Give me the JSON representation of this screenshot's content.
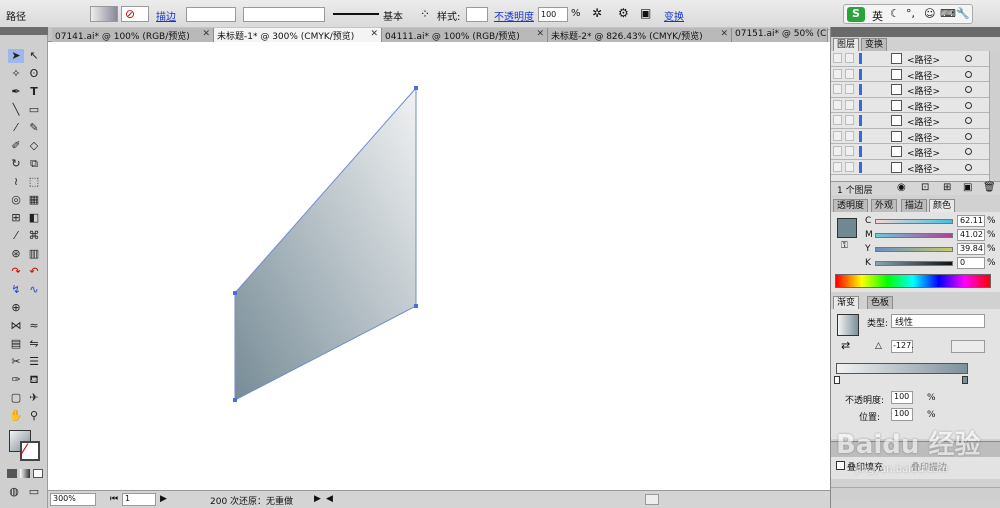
{
  "control_bar": {
    "selection_label": "路径",
    "stroke_link": "描边",
    "stroke_profile": "基本",
    "style_label": "样式:",
    "opacity_link": "不透明度",
    "opacity_value": "100",
    "opacity_unit": "%",
    "transform_link": "变换",
    "ime_label": "英"
  },
  "tabs": [
    {
      "label": "07141.ai* @ 100% (RGB/预览)"
    },
    {
      "label": "未标题-1* @ 300% (CMYK/预览)"
    },
    {
      "label": "04111.ai* @ 100% (RGB/预览)"
    },
    {
      "label": "未标题-2* @ 826.43% (CMYK/预览)"
    },
    {
      "label": "07151.ai* @ 50% (C"
    }
  ],
  "status": {
    "zoom": "300%",
    "page": "1",
    "message": "200 次还原：无重做"
  },
  "layers_panel": {
    "tabs": [
      "图层",
      "变换"
    ],
    "rows": [
      {
        "name": "<路径>"
      },
      {
        "name": "<路径>"
      },
      {
        "name": "<路径>"
      },
      {
        "name": "<路径>"
      },
      {
        "name": "<路径>"
      },
      {
        "name": "<路径>"
      },
      {
        "name": "<路径>"
      },
      {
        "name": "<路径>"
      }
    ],
    "footer": "1 个图层"
  },
  "color_panel": {
    "tabs": [
      "透明度",
      "外观",
      "描边",
      "颜色"
    ],
    "channels": [
      {
        "label": "C",
        "value": "62.11",
        "unit": "%"
      },
      {
        "label": "M",
        "value": "41.02",
        "unit": "%"
      },
      {
        "label": "Y",
        "value": "39.84",
        "unit": "%"
      },
      {
        "label": "K",
        "value": "0",
        "unit": "%"
      }
    ]
  },
  "gradient_panel": {
    "tabs": [
      "渐变",
      "色板"
    ],
    "type_label": "类型:",
    "type_value": "线性",
    "angle_value": "-127.",
    "opacity_label": "不透明度:",
    "opacity_value": "100",
    "opacity_unit": "%",
    "location_label": "位置:",
    "location_value": "100",
    "location_unit": "%"
  },
  "bottom_panel": {
    "overprint_fill": "叠印填充",
    "overprint_stroke": "叠印描边"
  },
  "watermark": {
    "brand": "Baidu 经验",
    "url": "jingyan.baidu.com"
  },
  "colors": {
    "shape_light": "#eef0f1",
    "shape_dark": "#7d909a",
    "selection": "#4b6fd6"
  }
}
